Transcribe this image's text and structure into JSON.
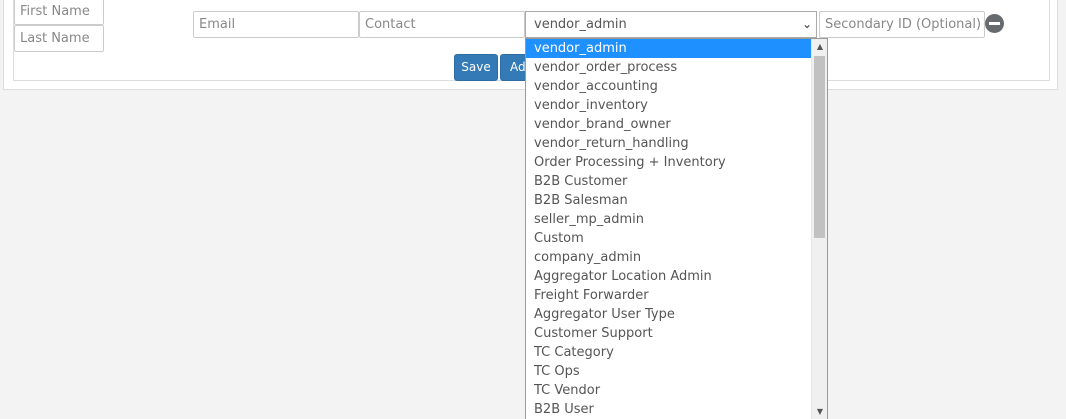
{
  "form": {
    "first_name_placeholder": "First Name",
    "last_name_placeholder": "Last Name",
    "email_placeholder": "Email",
    "contact_placeholder": "Contact",
    "role_selected": "vendor_admin",
    "secondary_id_placeholder": "Secondary ID (Optional)"
  },
  "buttons": {
    "save_label": "Save",
    "add_label_partial": "Ad"
  },
  "role_options": [
    "vendor_admin",
    "vendor_order_process",
    "vendor_accounting",
    "vendor_inventory",
    "vendor_brand_owner",
    "vendor_return_handling",
    "Order Processing + Inventory",
    "B2B Customer",
    "B2B Salesman",
    "seller_mp_admin",
    "Custom",
    "company_admin",
    "Aggregator Location Admin",
    "Freight Forwarder",
    "Aggregator User Type",
    "Customer Support",
    "TC Category",
    "TC Ops",
    "TC Vendor",
    "B2B User"
  ],
  "highlighted_option": "vendor_admin",
  "colors": {
    "primary_button": "#337ab7",
    "option_highlight": "#1e90ff"
  },
  "icons": {
    "remove": "remove-circle-icon",
    "select_chevron": "chevron-down-icon"
  }
}
